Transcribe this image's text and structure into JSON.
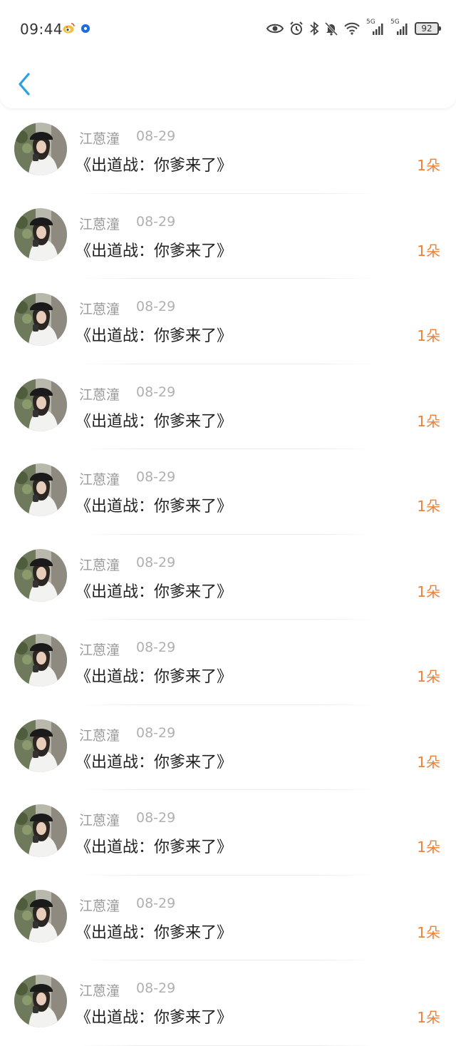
{
  "status_bar": {
    "time": "09:44",
    "network_1": "5G",
    "network_2": "5G",
    "battery": "92"
  },
  "list": {
    "items": [
      {
        "name": "江蒽潼",
        "date": "08-29",
        "title": "《出道战：你爹来了》",
        "count": "1朵"
      },
      {
        "name": "江蒽潼",
        "date": "08-29",
        "title": "《出道战：你爹来了》",
        "count": "1朵"
      },
      {
        "name": "江蒽潼",
        "date": "08-29",
        "title": "《出道战：你爹来了》",
        "count": "1朵"
      },
      {
        "name": "江蒽潼",
        "date": "08-29",
        "title": "《出道战：你爹来了》",
        "count": "1朵"
      },
      {
        "name": "江蒽潼",
        "date": "08-29",
        "title": "《出道战：你爹来了》",
        "count": "1朵"
      },
      {
        "name": "江蒽潼",
        "date": "08-29",
        "title": "《出道战：你爹来了》",
        "count": "1朵"
      },
      {
        "name": "江蒽潼",
        "date": "08-29",
        "title": "《出道战：你爹来了》",
        "count": "1朵"
      },
      {
        "name": "江蒽潼",
        "date": "08-29",
        "title": "《出道战：你爹来了》",
        "count": "1朵"
      },
      {
        "name": "江蒽潼",
        "date": "08-29",
        "title": "《出道战：你爹来了》",
        "count": "1朵"
      },
      {
        "name": "江蒽潼",
        "date": "08-29",
        "title": "《出道战：你爹来了》",
        "count": "1朵"
      },
      {
        "name": "江蒽潼",
        "date": "08-29",
        "title": "《出道战：你爹来了》",
        "count": "1朵"
      }
    ]
  },
  "colors": {
    "accent": "#ef8036",
    "back_arrow": "#2aa0e8"
  },
  "icons": {
    "back": "chevron-left-icon",
    "status": [
      "weibo-icon",
      "notification-dot-icon",
      "eye-icon",
      "alarm-icon",
      "bluetooth-icon",
      "bell-off-icon",
      "wifi-icon",
      "signal-icon",
      "signal-icon",
      "battery-icon"
    ]
  }
}
